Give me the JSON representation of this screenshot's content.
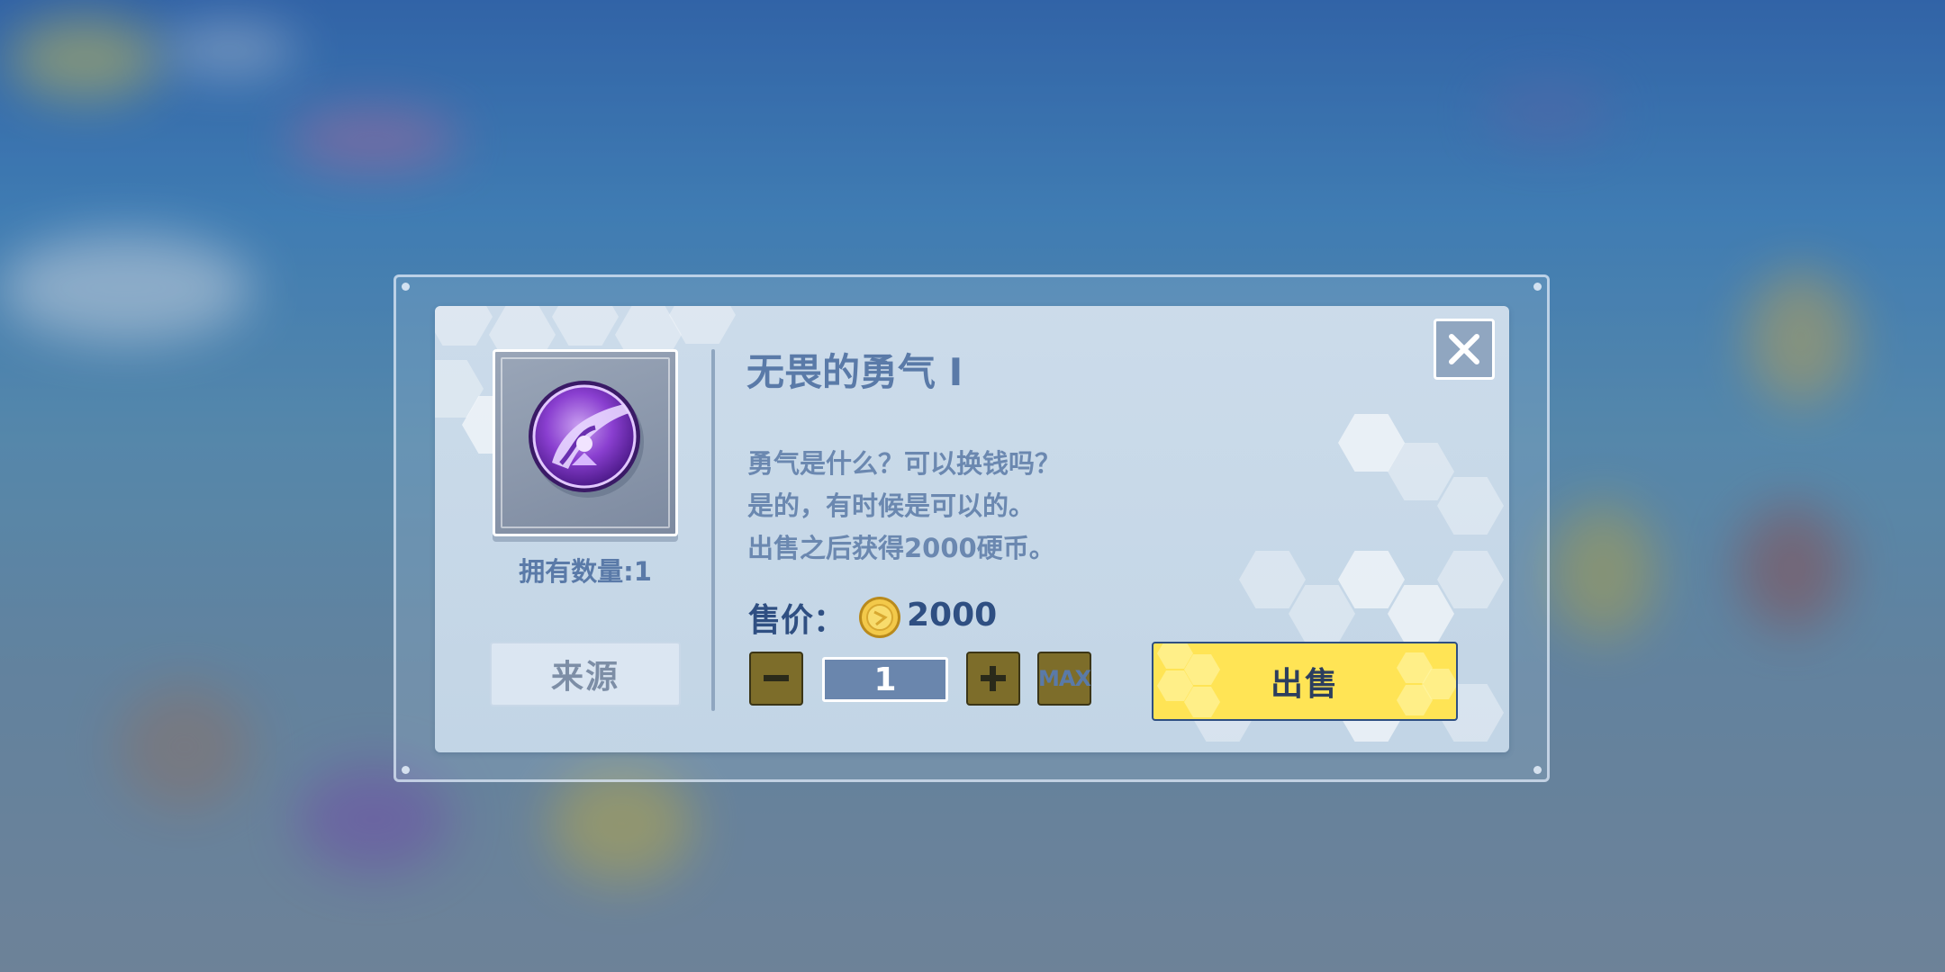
{
  "item": {
    "name": "无畏的勇气 I",
    "owned_label": "拥有数量:",
    "owned_count": "1",
    "icon": "purple-medal-icon",
    "description": [
      "勇气是什么？可以换钱吗？",
      "是的，有时候是可以的。",
      "出售之后获得2000硬币。"
    ]
  },
  "source_button": {
    "label": "来源"
  },
  "price": {
    "label": "售价：",
    "value": "2000",
    "icon": "gold-coin-icon"
  },
  "quantity": {
    "value": "1",
    "minus_icon": "minus-icon",
    "plus_icon": "plus-icon",
    "max_label": "MAX"
  },
  "sell_button": {
    "label": "出售"
  },
  "close_button": {
    "icon": "close-icon"
  },
  "colors": {
    "title_text": "#5a7aa8",
    "price_text": "#2f4f82",
    "sell_button_bg": "#ffe455",
    "stepper_bg": "#7d6d2a",
    "quantity_box_bg": "#6a86ad"
  }
}
